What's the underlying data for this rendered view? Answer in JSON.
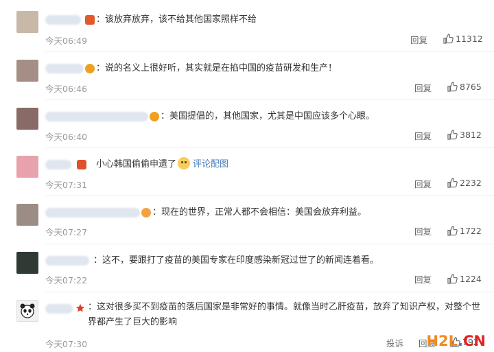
{
  "comments": [
    {
      "text": "：该放弃放弃，该不给其他国家照样不给",
      "time": "今天06:49",
      "reply": "回复",
      "likes": "11312",
      "avatar": "#c8b8a8",
      "badge": "#e05a2b"
    },
    {
      "text": "：说的名义上很好听，其实就是在掐中国的疫苗研发和生产！",
      "time": "今天06:46",
      "reply": "回复",
      "likes": "8765",
      "avatar": "#a48e86",
      "badge": "#f0a020"
    },
    {
      "text": "：美国提倡的，其他国家，尤其是中国应该多个心眼。",
      "time": "今天06:40",
      "reply": "回复",
      "likes": "3812",
      "avatar": "#8a6a66",
      "badge": "#f0a020"
    },
    {
      "text": "小心韩国偷偷申遗了",
      "link": "评论配图",
      "time": "今天07:31",
      "reply": "回复",
      "likes": "2232",
      "avatar": "#e7a2ae",
      "badge": "#e0502a"
    },
    {
      "text": "：现在的世界，正常人都不会相信：美国会放弃利益。",
      "time": "今天07:27",
      "reply": "回复",
      "likes": "1722",
      "avatar": "#9c8c86",
      "badge": "#f2a240"
    },
    {
      "text": "：这不，要跟打了疫苗的美国专家在印度感染新冠过世了的新闻连着看。",
      "time": "今天07:22",
      "reply": "回复",
      "likes": "1224",
      "avatar": "#2f3a34",
      "badge": ""
    },
    {
      "text": "：这对很多买不到疫苗的落后国家是非常好的事情。就像当时乙肝疫苗，放弃了知识产权，对整个世界都产生了巨大的影响",
      "time": "今天07:30",
      "report": "投诉",
      "reply": "回复",
      "likes": "792",
      "avatar": "#f1f1f1",
      "badge": "#e0402a"
    }
  ],
  "watermark": {
    "a": "H2L",
    "b": ".",
    "c": "CN"
  }
}
